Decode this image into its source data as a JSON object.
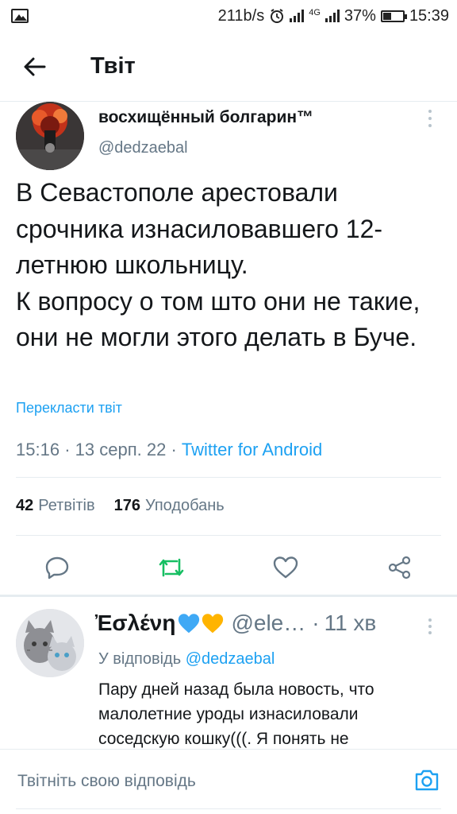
{
  "status_bar": {
    "speed": "211b/s",
    "network": "4G",
    "battery": "37%",
    "battery_level": 0.37,
    "time": "15:39"
  },
  "header": {
    "title": "Твіт"
  },
  "tweet": {
    "author_name": "восхищённый болгарин™",
    "author_handle": "@dedzaebal",
    "text": "В Севастополе арестовали срочника изнасиловавшего 12-летнюю школьницу.\nК вопросу о том што они не такие, они не могли этого делать в Буче.",
    "translate_label": "Перекласти твіт",
    "time": "15:16",
    "date": "13 серп. 22",
    "source": "Twitter for Android",
    "retweets_count": "42",
    "retweets_label": "Ретвітів",
    "likes_count": "176",
    "likes_label": "Уподобань"
  },
  "reply": {
    "author_name": "Ἐσλένη",
    "author_handle": "@ele…",
    "time": "11 хв",
    "replying_prefix": "У відповідь",
    "replying_handle": "@dedzaebal",
    "text": "Пару дней назад была новость, что малолетние уроды изнасиловали соседскую кошку(((. Я понять  не"
  },
  "compose": {
    "placeholder": "Твітніть свою відповідь"
  },
  "colors": {
    "accent": "#1da1f2",
    "secondary_text": "#657786",
    "retweet_green": "#17bf63",
    "divider": "#e6ecf0"
  },
  "icons": {
    "back": "arrow-left-icon",
    "more": "more-vertical-icon",
    "reply": "reply-icon",
    "retweet": "retweet-icon",
    "like": "heart-icon",
    "share": "share-icon",
    "camera": "camera-icon"
  }
}
